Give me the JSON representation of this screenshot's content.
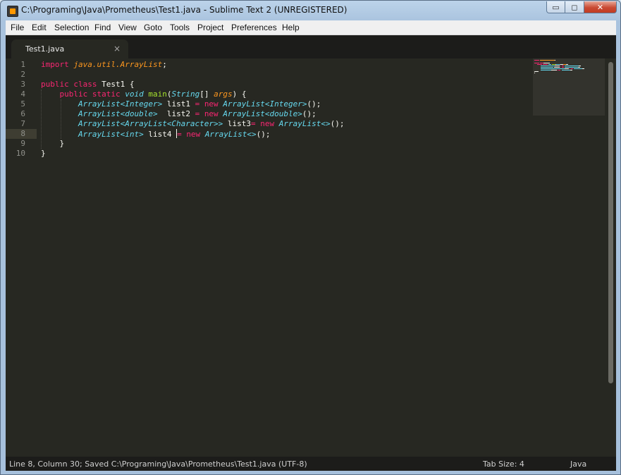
{
  "window": {
    "title": "C:\\Programing\\Java\\Prometheus\\Test1.java - Sublime Text 2 (UNREGISTERED)",
    "buttons": {
      "minimize": "▭",
      "maximize": "◻",
      "close": "✕"
    }
  },
  "menu": [
    "File",
    "Edit",
    "Selection",
    "Find",
    "View",
    "Goto",
    "Tools",
    "Project",
    "Preferences",
    "Help"
  ],
  "tab": {
    "label": "Test1.java",
    "close": "×"
  },
  "editor": {
    "active_line": 8,
    "line_numbers": [
      "1",
      "2",
      "3",
      "4",
      "5",
      "6",
      "7",
      "8",
      "9",
      "10"
    ],
    "lines": [
      [
        [
          "kw",
          "import"
        ],
        [
          "tx",
          " "
        ],
        [
          "ar",
          "java.util.ArrayList"
        ],
        [
          "tx",
          ";"
        ]
      ],
      [],
      [
        [
          "kw",
          "public"
        ],
        [
          "tx",
          " "
        ],
        [
          "kw",
          "class"
        ],
        [
          "tx",
          " Test1 {"
        ]
      ],
      [
        [
          "tx",
          "    "
        ],
        [
          "kw",
          "public"
        ],
        [
          "tx",
          " "
        ],
        [
          "kw",
          "static"
        ],
        [
          "tx",
          " "
        ],
        [
          "tp",
          "void"
        ],
        [
          "tx",
          " "
        ],
        [
          "fn",
          "main"
        ],
        [
          "tx",
          "("
        ],
        [
          "tp",
          "String"
        ],
        [
          "tx",
          "[] "
        ],
        [
          "ar",
          "args"
        ],
        [
          "tx",
          ") {"
        ]
      ],
      [
        [
          "tx",
          "        "
        ],
        [
          "tp",
          "ArrayList<Integer>"
        ],
        [
          "tx",
          " list1 "
        ],
        [
          "kw",
          "="
        ],
        [
          "tx",
          " "
        ],
        [
          "kw",
          "new"
        ],
        [
          "tx",
          " "
        ],
        [
          "tp",
          "ArrayList<Integer>"
        ],
        [
          "tx",
          "();"
        ]
      ],
      [
        [
          "tx",
          "        "
        ],
        [
          "tp",
          "ArrayList<double>"
        ],
        [
          "tx",
          "  list2 "
        ],
        [
          "kw",
          "="
        ],
        [
          "tx",
          " "
        ],
        [
          "kw",
          "new"
        ],
        [
          "tx",
          " "
        ],
        [
          "tp",
          "ArrayList<double>"
        ],
        [
          "tx",
          "();"
        ]
      ],
      [
        [
          "tx",
          "        "
        ],
        [
          "tp",
          "ArrayList<ArrayList<Character>>"
        ],
        [
          "tx",
          " list3"
        ],
        [
          "kw",
          "="
        ],
        [
          "tx",
          " "
        ],
        [
          "kw",
          "new"
        ],
        [
          "tx",
          " "
        ],
        [
          "tp",
          "ArrayList<>"
        ],
        [
          "tx",
          "();"
        ]
      ],
      [
        [
          "tx",
          "        "
        ],
        [
          "tp",
          "ArrayList<int>"
        ],
        [
          "tx",
          " list4 "
        ],
        [
          "cursor",
          ""
        ],
        [
          "kw",
          "="
        ],
        [
          "tx",
          " "
        ],
        [
          "kw",
          "new"
        ],
        [
          "tx",
          " "
        ],
        [
          "tp",
          "ArrayList<>"
        ],
        [
          "tx",
          "();"
        ]
      ],
      [
        [
          "tx",
          "    }"
        ]
      ],
      [
        [
          "tx",
          "}"
        ]
      ]
    ]
  },
  "status": {
    "left": "Line 8, Column 30; Saved C:\\Programing\\Java\\Prometheus\\Test1.java (UTF-8)",
    "tab_size": "Tab Size: 4",
    "syntax": "Java"
  },
  "colors": {
    "background": "#272822",
    "keyword": "#f92672",
    "type": "#66d9ef",
    "function": "#a6e22e",
    "argument": "#fd971f",
    "text": "#f8f8f2"
  },
  "icons": {
    "app": "sublime-text-icon",
    "tab_close": "close-icon"
  }
}
